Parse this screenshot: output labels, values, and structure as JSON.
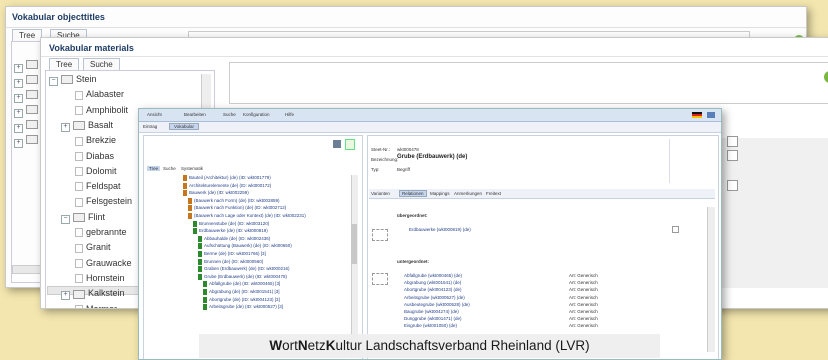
{
  "window1": {
    "title": "Vokabular objecttitles",
    "tabs": [
      "Tree",
      "Suche"
    ]
  },
  "window2": {
    "title": "Vokabular materials",
    "tabs": [
      "Tree",
      "Suche"
    ],
    "tree": [
      {
        "label": "Stein",
        "type": "folder",
        "expander": "−"
      },
      {
        "label": "Alabaster",
        "type": "leaf"
      },
      {
        "label": "Amphibolit",
        "type": "leaf"
      },
      {
        "label": "Basalt",
        "type": "folder",
        "expander": "+"
      },
      {
        "label": "Brekzie",
        "type": "leaf"
      },
      {
        "label": "Diabas",
        "type": "leaf"
      },
      {
        "label": "Dolomit",
        "type": "leaf"
      },
      {
        "label": "Feldspat",
        "type": "leaf"
      },
      {
        "label": "Felsgestein",
        "type": "leaf"
      },
      {
        "label": "Flint",
        "type": "folder",
        "expander": "−"
      },
      {
        "label": "gebrannte",
        "type": "leaf"
      },
      {
        "label": "Granit",
        "type": "leaf"
      },
      {
        "label": "Grauwacke",
        "type": "leaf"
      },
      {
        "label": "Hornstein",
        "type": "leaf"
      },
      {
        "label": "Kalkstein",
        "type": "folder",
        "expander": "+"
      },
      {
        "label": "Marmor",
        "type": "leaf"
      }
    ]
  },
  "window3": {
    "menu": [
      "Ansicht",
      "Bearbeiten",
      "Suche",
      "Konfiguration",
      "Hilfe"
    ],
    "subtabs": [
      "Eintrag",
      "Vokabular"
    ],
    "left_tabs": [
      "Tree",
      "Suche",
      "Systematik"
    ],
    "tree": [
      {
        "label": "Bauteil (Architektur) (de) (ID: wkt001779)",
        "icon": "orange",
        "indent": 0
      },
      {
        "label": "Architekturelemente (de) (ID: wkt000172)",
        "icon": "orange",
        "indent": 0
      },
      {
        "label": "Bauwerk (de) (ID: wkt002259)",
        "icon": "orange",
        "indent": 0
      },
      {
        "label": "(Bauwerk nach Form) (de) (ID: wkt002859)",
        "icon": "orange",
        "indent": 1
      },
      {
        "label": "(Bauwerk nach Funktion) (de) (ID: wkt002712)",
        "icon": "orange",
        "indent": 1
      },
      {
        "label": "(Bauwerk nach Lage oder Kontext) (de) (ID: wkt002231)",
        "icon": "orange",
        "indent": 1
      },
      {
        "label": "Brunnenstube (de) (ID: wkt003120)",
        "icon": "green",
        "indent": 2
      },
      {
        "label": "Erdbauwerke (de) (ID: wkt000819)",
        "icon": "green",
        "indent": 2
      },
      {
        "label": "Abbauhalde (de) (ID: wkt002436)",
        "icon": "green",
        "indent": 3
      },
      {
        "label": "Aufschüttung (Bauwerk) (de) (ID: wkt00650)",
        "icon": "green",
        "indent": 3
      },
      {
        "label": "Berme (de) (ID: wkt001766) [3]",
        "icon": "green",
        "indent": 3
      },
      {
        "label": "Brunnen (de) (ID: wkt000560)",
        "icon": "green",
        "indent": 3
      },
      {
        "label": "Graben (Erdbauwerk) (de) (ID: wkt000216)",
        "icon": "green",
        "indent": 3
      },
      {
        "label": "Grube (Erdbauwerk) (de) (ID: wkt000478)",
        "icon": "green",
        "indent": 3
      },
      {
        "label": "Abfallgrube (de) (ID: wkt000465) [3]",
        "icon": "green",
        "indent": 4
      },
      {
        "label": "Abgrabung (de) (ID: wkt001541) [3]",
        "icon": "green",
        "indent": 4
      },
      {
        "label": "Abortgrube (de) (ID: wkt004123) [3]",
        "icon": "green",
        "indent": 4
      },
      {
        "label": "Arbeitsgrube (de) (ID: wkt000527) [3]",
        "icon": "green",
        "indent": 4
      }
    ],
    "detail": {
      "steet_label": "Steet-Nr.:",
      "steet_value": "wkt000478",
      "bez_label": "Bezeichnung:",
      "bez_value": "Grube (Erdbauwerk) (de)",
      "typ_label": "Typ:",
      "typ_value": "Begriff",
      "tabs": [
        "Varianten",
        "Relationen",
        "Mappings",
        "Anmerkungen",
        "Freitext"
      ],
      "uber_label": "übergeordnet:",
      "uber_item": "Erdbauwerke (wkt000819) (de)",
      "unter_label": "untergeordnet:",
      "unter_items": [
        {
          "name": "Abfallgrube (wkt000465) (de)",
          "art": "Art: Generisch"
        },
        {
          "name": "Abgrabung (wkt001541) (de)",
          "art": "Art: Generisch"
        },
        {
          "name": "Abortgrube (wkt004123) (de)",
          "art": "Art: Generisch"
        },
        {
          "name": "Arbeitsgrube (wkt000527) (de)",
          "art": "Art: Generisch"
        },
        {
          "name": "Ausbeutegrube (wkt000528) (de)",
          "art": "Art: Generisch"
        },
        {
          "name": "Baugrube (wkt004274) (de)",
          "art": "Art: Generisch"
        },
        {
          "name": "Dunggrube (wkt001471) (de)",
          "art": "Art: Generisch"
        },
        {
          "name": "Eisgrube (wkt001050) (de)",
          "art": "Art: Generisch"
        }
      ]
    }
  },
  "caption": {
    "parts": [
      {
        "text": "W",
        "bold": true
      },
      {
        "text": "ort",
        "bold": false
      },
      {
        "text": "N",
        "bold": true
      },
      {
        "text": "etz",
        "bold": false
      },
      {
        "text": "K",
        "bold": true
      },
      {
        "text": "ultur Landschaftsverband Rheinland (LVR)",
        "bold": false
      }
    ]
  },
  "colors": {
    "background": "#f3e6ae",
    "menu_bar": "#d9e4f3",
    "link": "#223f8a",
    "green_icon": "#2c8a2c",
    "orange_icon": "#c6761c"
  }
}
